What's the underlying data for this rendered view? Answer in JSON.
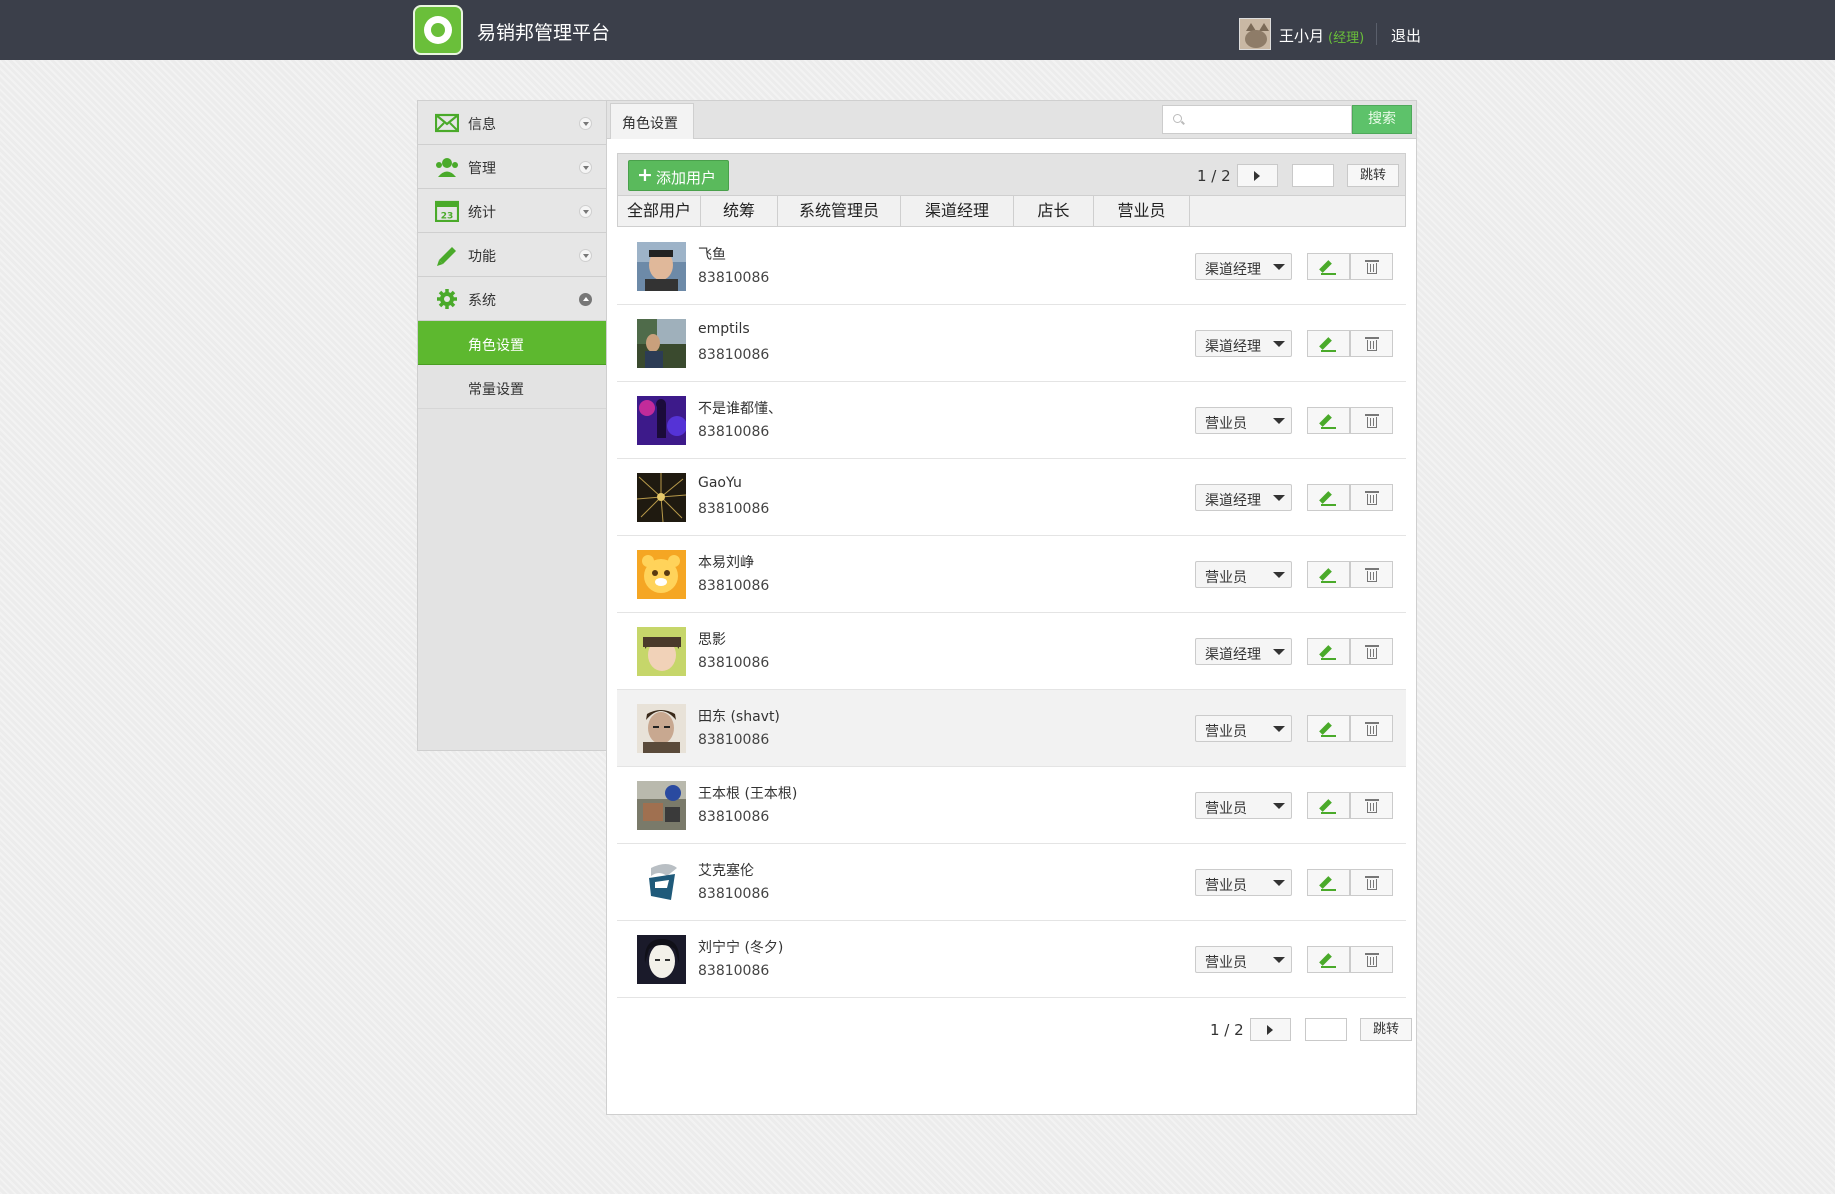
{
  "header": {
    "app_title": "易销邦管理平台",
    "user_name": "王小月",
    "user_role": "(经理)",
    "logout": "退出"
  },
  "sidebar": {
    "items": [
      {
        "label": "信息",
        "icon": "mail-icon",
        "expanded": false
      },
      {
        "label": "管理",
        "icon": "users-icon",
        "expanded": false
      },
      {
        "label": "统计",
        "icon": "calendar-icon",
        "expanded": false
      },
      {
        "label": "功能",
        "icon": "pencil-icon",
        "expanded": false
      },
      {
        "label": "系统",
        "icon": "gear-icon",
        "expanded": true
      }
    ],
    "subitems": [
      {
        "label": "角色设置",
        "active": true
      },
      {
        "label": "常量设置",
        "active": false
      }
    ]
  },
  "main": {
    "tab": "角色设置",
    "search": {
      "placeholder": "",
      "button": "搜索"
    },
    "toolbar": {
      "add_label": "添加用户"
    },
    "pager_top": {
      "text": "1 / 2",
      "jump": "跳转"
    },
    "pager_bottom": {
      "text": "1 / 2",
      "jump": "跳转"
    },
    "filters": [
      "全部用户",
      "统筹",
      "系统管理员",
      "渠道经理",
      "店长",
      "营业员"
    ],
    "users": [
      {
        "name": "飞鱼",
        "id": "83810086",
        "role": "渠道经理"
      },
      {
        "name": "emptils",
        "id": "83810086",
        "role": "渠道经理"
      },
      {
        "name": "不是谁都懂、",
        "id": "83810086",
        "role": "营业员"
      },
      {
        "name": "GaoYu",
        "id": "83810086",
        "role": "渠道经理"
      },
      {
        "name": "本易刘峥",
        "id": "83810086",
        "role": "营业员"
      },
      {
        "name": "思影",
        "id": "83810086",
        "role": "渠道经理"
      },
      {
        "name": "田东 (shavt)",
        "id": "83810086",
        "role": "营业员"
      },
      {
        "name": "王本根 (王本根)",
        "id": "83810086",
        "role": "营业员"
      },
      {
        "name": "艾克塞伦",
        "id": "83810086",
        "role": "营业员"
      },
      {
        "name": "刘宁宁 (冬夕)",
        "id": "83810086",
        "role": "营业员"
      }
    ]
  },
  "colors": {
    "accent": "#5db82f",
    "topbar": "#3b3f4a",
    "search_button": "#5dc26a"
  }
}
